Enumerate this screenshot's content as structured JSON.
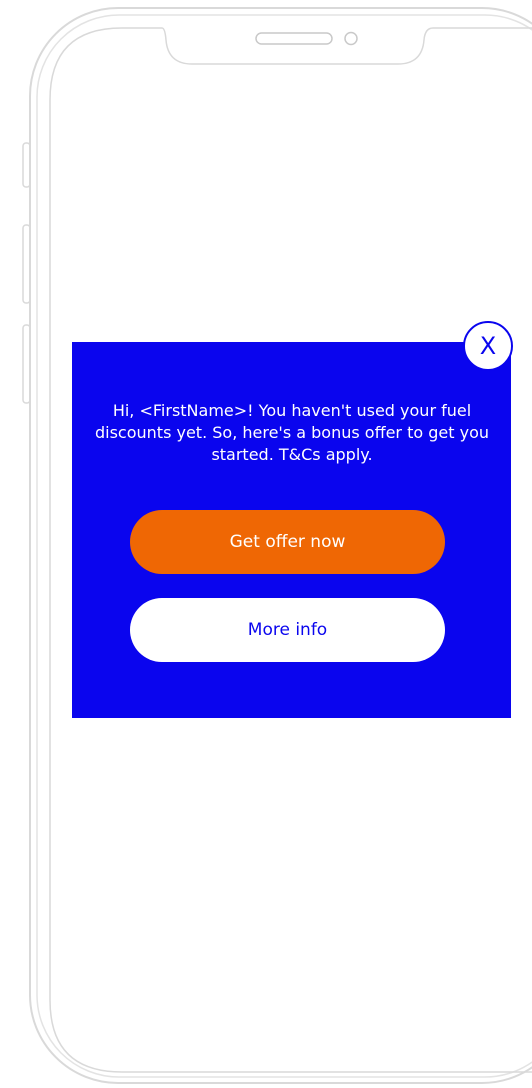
{
  "popup": {
    "message": "Hi, <FirstName>! You haven't used your fuel discounts yet. So, here's a bonus offer to get you started. T&Cs apply.",
    "close_label": "X",
    "primary_button_label": "Get offer now",
    "secondary_button_label": "More info"
  },
  "colors": {
    "modal_background": "#0a05ee",
    "primary_button": "#ef6704",
    "secondary_button": "#ffffff",
    "phone_outline": "#d9d9d9"
  }
}
